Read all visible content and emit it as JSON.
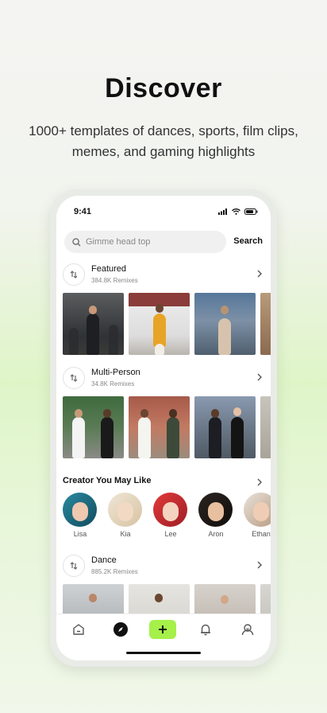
{
  "hero": {
    "title": "Discover",
    "subtitle": "1000+ templates of dances, sports, film clips, memes, and gaming highlights"
  },
  "status_bar": {
    "time": "9:41"
  },
  "search": {
    "placeholder": "Gimme head top",
    "button_label": "Search"
  },
  "sections": [
    {
      "title": "Featured",
      "subtitle": "384.8K Remixes"
    },
    {
      "title": "Multi-Person",
      "subtitle": "34.8K Remixes"
    },
    {
      "title": "Dance",
      "subtitle": "885.2K Remixes"
    }
  ],
  "creators": {
    "title": "Creator You May Like",
    "items": [
      {
        "name": "Lisa"
      },
      {
        "name": "Kia"
      },
      {
        "name": "Lee"
      },
      {
        "name": "Aron"
      },
      {
        "name": "Ethan"
      }
    ]
  },
  "tabbar": {
    "items": [
      "home-icon",
      "compass-icon",
      "plus-icon",
      "bell-icon",
      "profile-icon"
    ],
    "accent": "#a6f04a"
  }
}
